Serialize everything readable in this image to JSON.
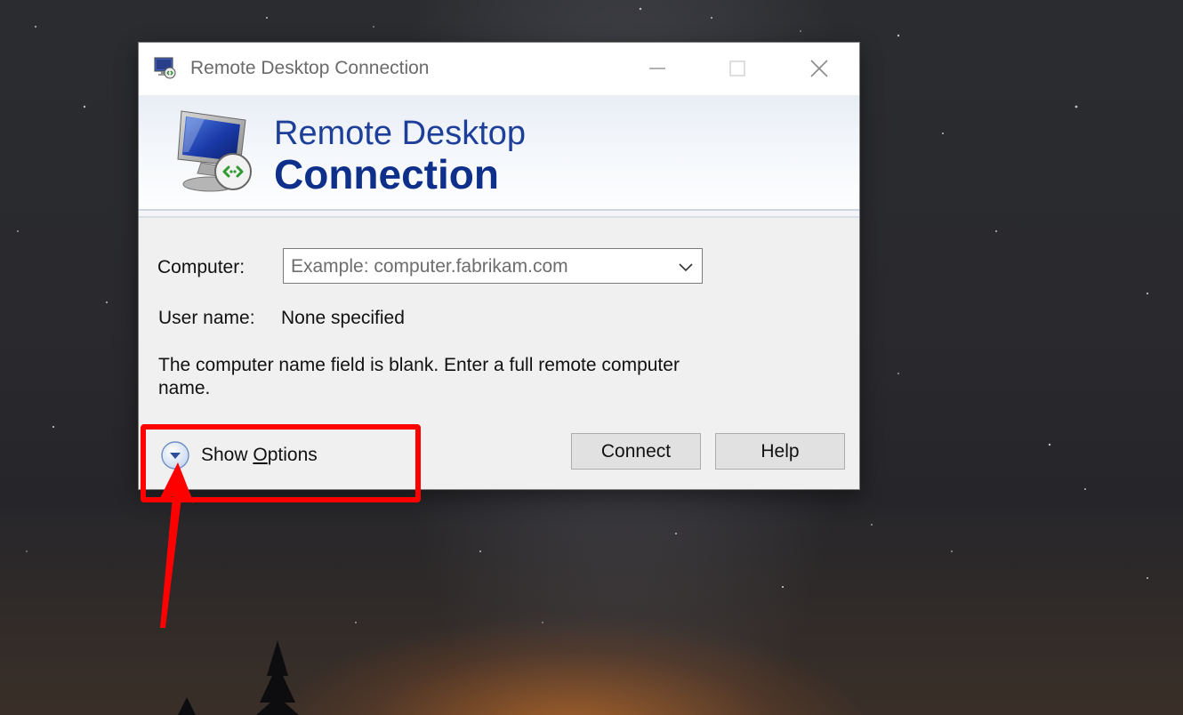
{
  "window": {
    "title": "Remote Desktop Connection",
    "controls": {
      "minimize": "minimize",
      "maximize": "maximize",
      "close": "close"
    }
  },
  "banner": {
    "line1": "Remote Desktop",
    "line2": "Connection"
  },
  "form": {
    "computer_label": "Computer:",
    "computer_placeholder": "Example: computer.fabrikam.com",
    "user_label": "User name:",
    "user_value": "None specified",
    "message": "The computer name field is blank. Enter a full remote computer name."
  },
  "footer": {
    "show_options_pre": "Show ",
    "show_options_access": "O",
    "show_options_post": "ptions",
    "connect_label": "Connect",
    "help_label": "Help"
  },
  "icons": {
    "app": "remote-desktop-icon",
    "banner": "remote-desktop-monitor-icon",
    "combo": "chevron-down-icon",
    "options": "expand-circle-icon"
  },
  "colors": {
    "highlight": "#ff0000",
    "banner_text": "#1d3f9a",
    "window_bg": "#f0f0f0"
  }
}
